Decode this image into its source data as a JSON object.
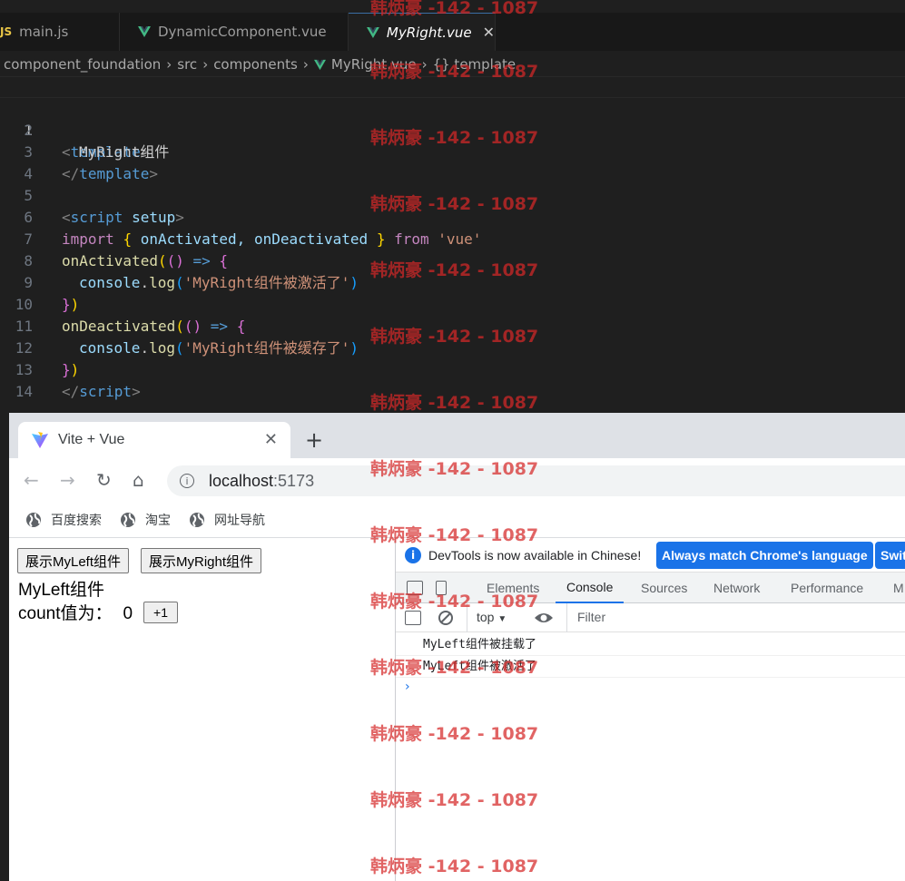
{
  "editor": {
    "tabs": [
      {
        "icon": "JS",
        "label": "main.js"
      },
      {
        "label": "DynamicComponent.vue"
      },
      {
        "label": "MyRight.vue",
        "close": "✕"
      }
    ],
    "breadcrumb": [
      "component_foundation",
      "src",
      "components",
      "MyRight.vue",
      "{} template"
    ],
    "line_numbers": [
      "1",
      "2",
      "3",
      "4",
      "5",
      "6",
      "7",
      "8",
      "9",
      "10",
      "11",
      "12",
      "13",
      "14"
    ],
    "code": {
      "l1_open": "<",
      "l1_tag": "template",
      "l1_close": ">",
      "l2_text": "MyRight组件",
      "l3_open": "</",
      "l3_tag": "template",
      "l3_close": ">",
      "l5_open": "<",
      "l5_tag": "script",
      "l5_attr": "setup",
      "l5_close": ">",
      "l6_import": "import",
      "l6_lb": "{",
      "l6_names": "onActivated, onDeactivated",
      "l6_rb": "}",
      "l6_from": "from",
      "l6_str": "'vue'",
      "l7_fn": "onActivated",
      "l7_p": "(",
      "l7_pp": "()",
      "l7_arrow": "=>",
      "l7_b": "{",
      "l8_obj": "console",
      "l8_dot": ".",
      "l8_fn": "log",
      "l8_p": "(",
      "l8_str": "'MyRight组件被激活了'",
      "l8_pc": ")",
      "l9_b": "}",
      "l9_p": ")",
      "l10_fn": "onDeactivated",
      "l10_p": "(",
      "l10_pp": "()",
      "l10_arrow": "=>",
      "l10_b": "{",
      "l11_obj": "console",
      "l11_dot": ".",
      "l11_fn": "log",
      "l11_p": "(",
      "l11_str": "'MyRight组件被缓存了'",
      "l11_pc": ")",
      "l12_b": "}",
      "l12_p": ")",
      "l13_open": "</",
      "l13_tag": "script",
      "l13_close": ">"
    }
  },
  "browser": {
    "tab_title": "Vite + Vue",
    "tab_close": "✕",
    "new_tab": "+",
    "url_host": "localhost",
    "url_port": ":5173",
    "nav": {
      "back": "←",
      "forward": "→",
      "reload": "↻",
      "home": "⌂",
      "info": "i"
    },
    "bookmarks": [
      "百度搜索",
      "淘宝",
      "网址导航"
    ]
  },
  "page": {
    "btn_left": "展示MyLeft组件",
    "btn_right": "展示MyRight组件",
    "component_title": "MyLeft组件",
    "count_label": "count值为：",
    "count_value": "0",
    "plus_button": "+1"
  },
  "devtools": {
    "banner_text": "DevTools is now available in Chinese!",
    "banner_btn_match": "Always match Chrome's language",
    "banner_btn_switch": "Swit",
    "tabs": [
      "Elements",
      "Console",
      "Sources",
      "Network",
      "Performance",
      "M"
    ],
    "context": "top",
    "filter_placeholder": "Filter",
    "console_lines": [
      "MyLeft组件被挂载了",
      "MyLeft组件被激活了"
    ],
    "prompt": "›"
  },
  "watermark": "韩炳豪 -142 - 1087",
  "colors": {
    "accent": "#1a73e8",
    "vue_green": "#42b883",
    "watermark": "#d62828"
  }
}
